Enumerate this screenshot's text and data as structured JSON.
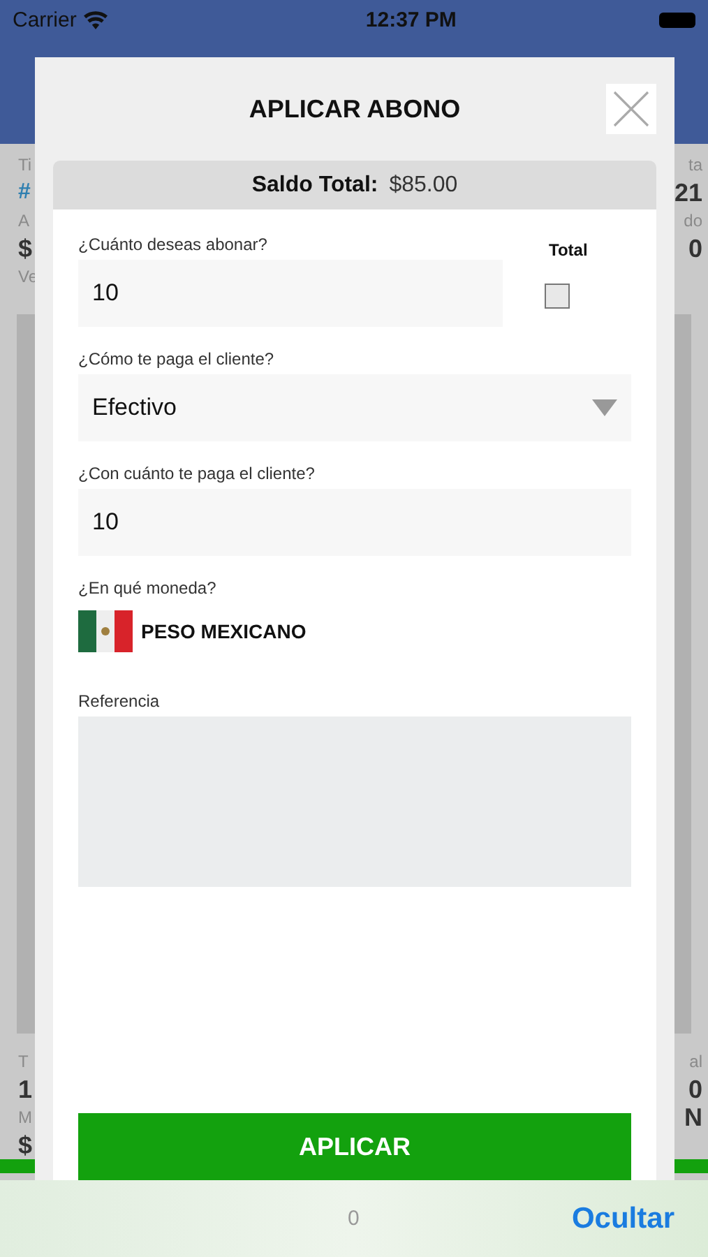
{
  "status_bar": {
    "carrier": "Carrier",
    "time": "12:37 PM"
  },
  "background": {
    "top_left": [
      {
        "text": "Ti",
        "kind": "label"
      },
      {
        "text": "#",
        "kind": "link"
      },
      {
        "text": "A",
        "kind": "label"
      },
      {
        "text": "$",
        "kind": "value"
      },
      {
        "text": "Ve",
        "kind": "label"
      }
    ],
    "top_right": [
      {
        "text": "ta",
        "kind": "label"
      },
      {
        "text": "21",
        "kind": "value"
      },
      {
        "text": "do",
        "kind": "label"
      },
      {
        "text": "0",
        "kind": "value"
      }
    ],
    "bottom_left": [
      {
        "text": "T",
        "kind": "label"
      },
      {
        "text": "1",
        "kind": "value"
      },
      {
        "text": "M",
        "kind": "label"
      },
      {
        "text": "$",
        "kind": "value"
      }
    ],
    "bottom_right": [
      {
        "text": "al",
        "kind": "label"
      },
      {
        "text": "0",
        "kind": "value"
      },
      {
        "text": "N",
        "kind": "value"
      }
    ]
  },
  "dialog": {
    "title": "APLICAR ABONO",
    "balance": {
      "label": "Saldo Total:",
      "value": "$85.00"
    },
    "amount": {
      "label": "¿Cuánto deseas abonar?",
      "value": "10"
    },
    "total_checkbox": {
      "label": "Total",
      "checked": false
    },
    "payment_method": {
      "label": "¿Cómo te paga el cliente?",
      "value": "Efectivo"
    },
    "paid_amount": {
      "label": "¿Con cuánto te paga el cliente?",
      "value": "10"
    },
    "currency": {
      "label": "¿En qué moneda?",
      "value": "PESO MEXICANO"
    },
    "reference": {
      "label": "Referencia"
    },
    "button": "APLICAR"
  },
  "keyboard_bar": {
    "value": "0",
    "action": "Ocultar"
  }
}
